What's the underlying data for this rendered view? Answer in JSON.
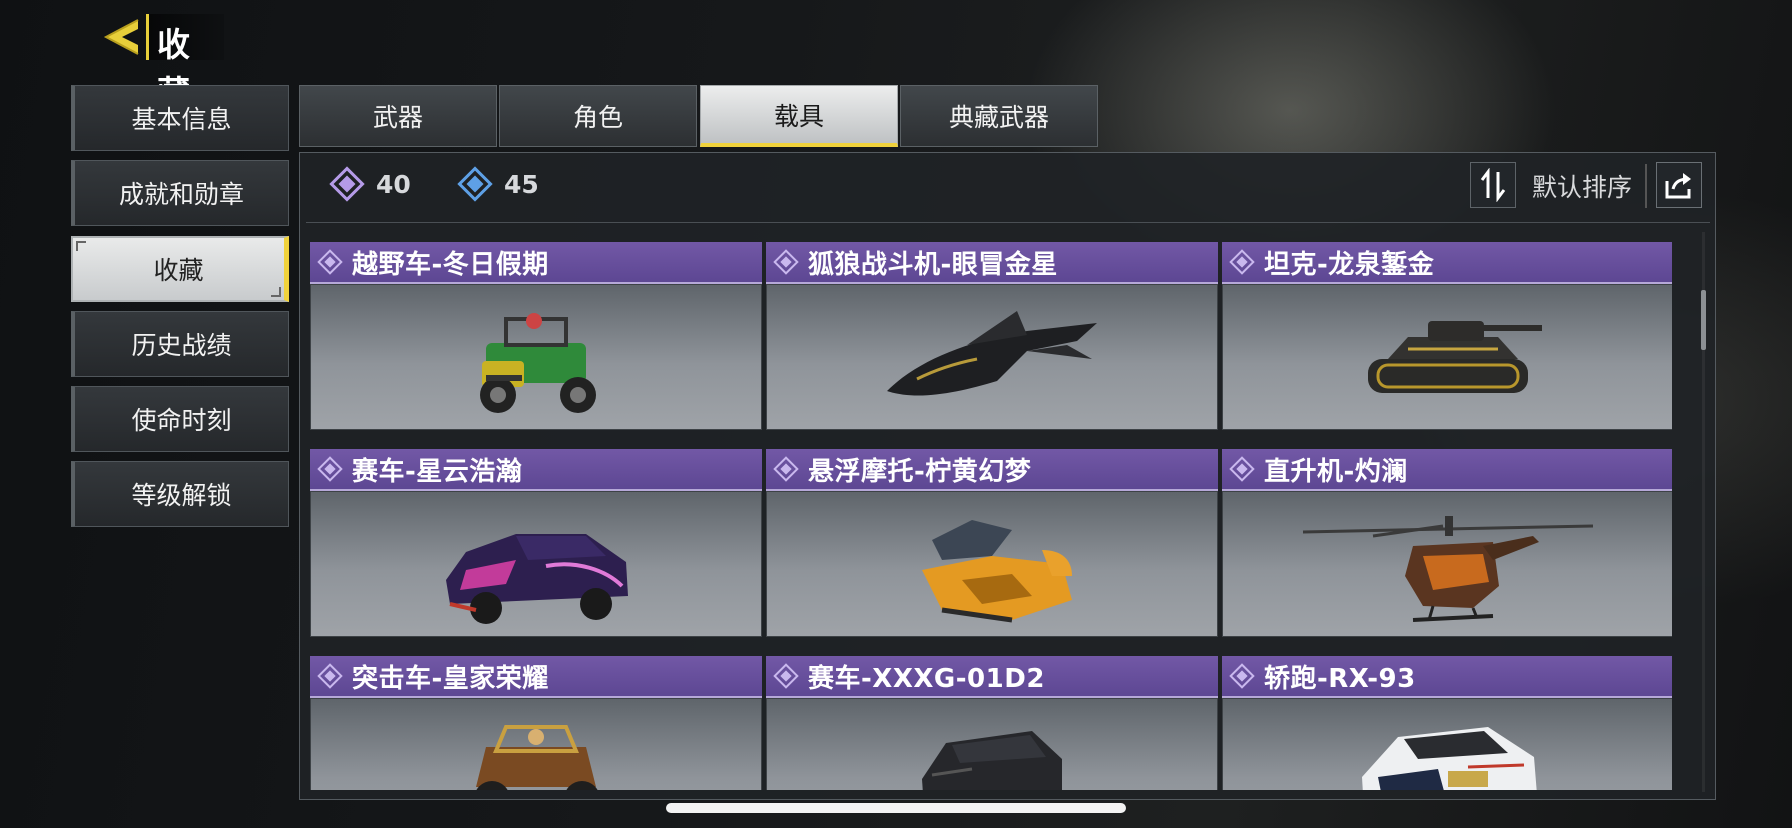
{
  "header": {
    "title": "收藏"
  },
  "sidebar": {
    "items": [
      {
        "label": "基本信息"
      },
      {
        "label": "成就和勋章"
      },
      {
        "label": "收藏"
      },
      {
        "label": "历史战绩"
      },
      {
        "label": "使命时刻"
      },
      {
        "label": "等级解锁"
      }
    ],
    "active_index": 2
  },
  "tabs": {
    "items": [
      {
        "label": "武器"
      },
      {
        "label": "角色"
      },
      {
        "label": "载具"
      },
      {
        "label": "典藏武器"
      }
    ],
    "active_index": 2
  },
  "toolbar": {
    "currency_purple": "40",
    "currency_blue": "45",
    "sort_label": "默认排序"
  },
  "cards": [
    {
      "name": "越野车-冬日假期",
      "vehicle": "offroad-jeep"
    },
    {
      "name": "狐狼战斗机-眼冒金星",
      "vehicle": "fighter-jet"
    },
    {
      "name": "坦克-龙泉錾金",
      "vehicle": "tank"
    },
    {
      "name": "赛车-星云浩瀚",
      "vehicle": "race-car"
    },
    {
      "name": "悬浮摩托-柠黄幻梦",
      "vehicle": "hover-bike"
    },
    {
      "name": "直升机-灼澜",
      "vehicle": "helicopter"
    },
    {
      "name": "突击车-皇家荣耀",
      "vehicle": "assault-buggy"
    },
    {
      "name": "赛车-XXXG-01D2",
      "vehicle": "race-car-dark"
    },
    {
      "name": "轿跑-RX-93",
      "vehicle": "sports-coupe"
    }
  ],
  "colors": {
    "accent": "#f0d23c",
    "card_header": "#6a52a0",
    "currency_purple": "#b59be8",
    "currency_blue": "#5ea0e6"
  },
  "icons": {
    "back": "back-arrow-icon",
    "sort": "sort-toggle-icon",
    "share": "share-icon",
    "rarity": "diamond-icon"
  }
}
